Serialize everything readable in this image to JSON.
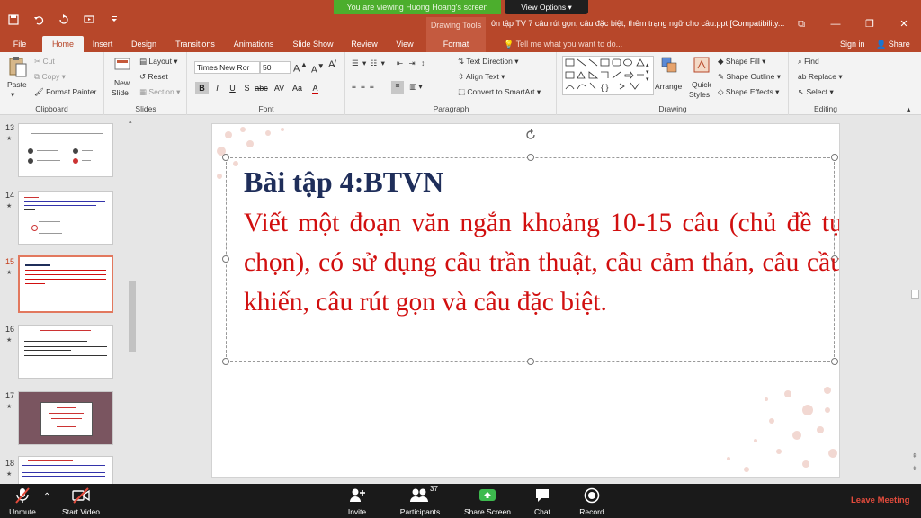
{
  "zoom_banner": {
    "viewing": "You are viewing Huong Hoang's screen",
    "view_options": "View Options"
  },
  "titlebar": {
    "context_header": "Drawing Tools",
    "title": "ôn tập TV 7 câu rút gọn, câu đặc biệt, thêm trạng ngữ cho câu.ppt [Compatibility..."
  },
  "tabs": [
    {
      "label": "File"
    },
    {
      "label": "Home"
    },
    {
      "label": "Insert"
    },
    {
      "label": "Design"
    },
    {
      "label": "Transitions"
    },
    {
      "label": "Animations"
    },
    {
      "label": "Slide Show"
    },
    {
      "label": "Review"
    },
    {
      "label": "View"
    },
    {
      "label": "Format"
    }
  ],
  "tellme": "Tell me what you want to do...",
  "signin": "Sign in",
  "share": "Share",
  "ribbon": {
    "clipboard": {
      "label": "Clipboard",
      "paste": "Paste",
      "cut": "Cut",
      "copy": "Copy",
      "format_painter": "Format Painter"
    },
    "slides": {
      "label": "Slides",
      "new_slide_1": "New",
      "new_slide_2": "Slide",
      "layout": "Layout",
      "reset": "Reset",
      "section": "Section"
    },
    "font": {
      "label": "Font",
      "font_name": "Times New Ror",
      "font_size": "50"
    },
    "paragraph": {
      "label": "Paragraph",
      "text_direction": "Text Direction",
      "align_text": "Align Text",
      "convert_smartart": "Convert to SmartArt"
    },
    "drawing": {
      "label": "Drawing",
      "arrange": "Arrange",
      "quick_styles_1": "Quick",
      "quick_styles_2": "Styles",
      "shape_fill": "Shape Fill",
      "shape_outline": "Shape Outline",
      "shape_effects": "Shape Effects"
    },
    "editing": {
      "label": "Editing",
      "find": "Find",
      "replace": "Replace",
      "select": "Select"
    }
  },
  "thumbnails": [
    {
      "num": "13",
      "star": "★"
    },
    {
      "num": "14",
      "star": "★"
    },
    {
      "num": "15",
      "star": "★"
    },
    {
      "num": "16",
      "star": "★"
    },
    {
      "num": "17",
      "star": "★"
    },
    {
      "num": "18",
      "star": "★"
    }
  ],
  "slide": {
    "title": "Bài tập 4:BTVN",
    "body": "Viết một đoạn văn ngắn khoảng 10-15 câu (chủ đề tự chọn), có sử dụng câu trần thuật, câu cảm thán, câu cầu khiến, câu rút gọn và câu đặc biệt."
  },
  "zoombar": {
    "unmute": "Unmute",
    "start_video": "Start Video",
    "invite": "Invite",
    "participants": "Participants",
    "participants_count": "37",
    "share_screen": "Share Screen",
    "chat": "Chat",
    "record": "Record",
    "leave": "Leave Meeting"
  },
  "colors": {
    "accent": "#b7472a",
    "slide_title": "#1f2e5a",
    "slide_body": "#d10f0f",
    "zoom_green": "#4cae2d",
    "leave_red": "#e24b3c"
  }
}
